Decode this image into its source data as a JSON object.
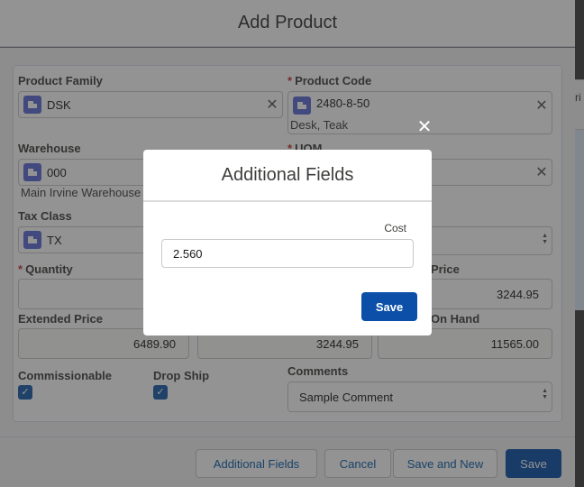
{
  "base": {
    "title": "Add Product",
    "side_tab_text": "ri",
    "fields": {
      "product_family": {
        "label": "Product Family",
        "value": "DSK"
      },
      "product_code": {
        "label": "Product Code",
        "value": "2480-8-50",
        "sub": "Desk, Teak"
      },
      "warehouse": {
        "label": "Warehouse",
        "value": "000",
        "sub": "Main Irvine Warehouse"
      },
      "uom": {
        "label": "UOM"
      },
      "tax_class": {
        "label": "Tax Class",
        "value": "TX"
      },
      "quantity": {
        "label": "Quantity"
      },
      "price": {
        "label_fragment": "Price",
        "value": "3244.95"
      },
      "extended_price": {
        "label": "Extended Price",
        "value": "6489.90"
      },
      "mid_value": "3244.95",
      "on_hand": {
        "label_fragment": "On Hand",
        "value": "11565.00"
      },
      "commissionable": {
        "label": "Commissionable",
        "checked": true
      },
      "drop_ship": {
        "label": "Drop Ship",
        "checked": true
      },
      "comments": {
        "label": "Comments",
        "value": "Sample Comment"
      }
    },
    "footer": {
      "additional_fields": "Additional Fields",
      "cancel": "Cancel",
      "save_and_new": "Save and New",
      "save": "Save"
    }
  },
  "dialog": {
    "title": "Additional Fields",
    "cost_label": "Cost",
    "cost_value": "2.560",
    "save": "Save",
    "close_glyph": "✕"
  },
  "icons": [
    "close-icon",
    "clear-icon",
    "lookup-record-icon",
    "checkbox-check-icon",
    "spinner-arrows-icon"
  ],
  "colors": {
    "brand": "#0b4fa8",
    "required": "#c23934",
    "lookup_chip": "#5a6ad6"
  }
}
